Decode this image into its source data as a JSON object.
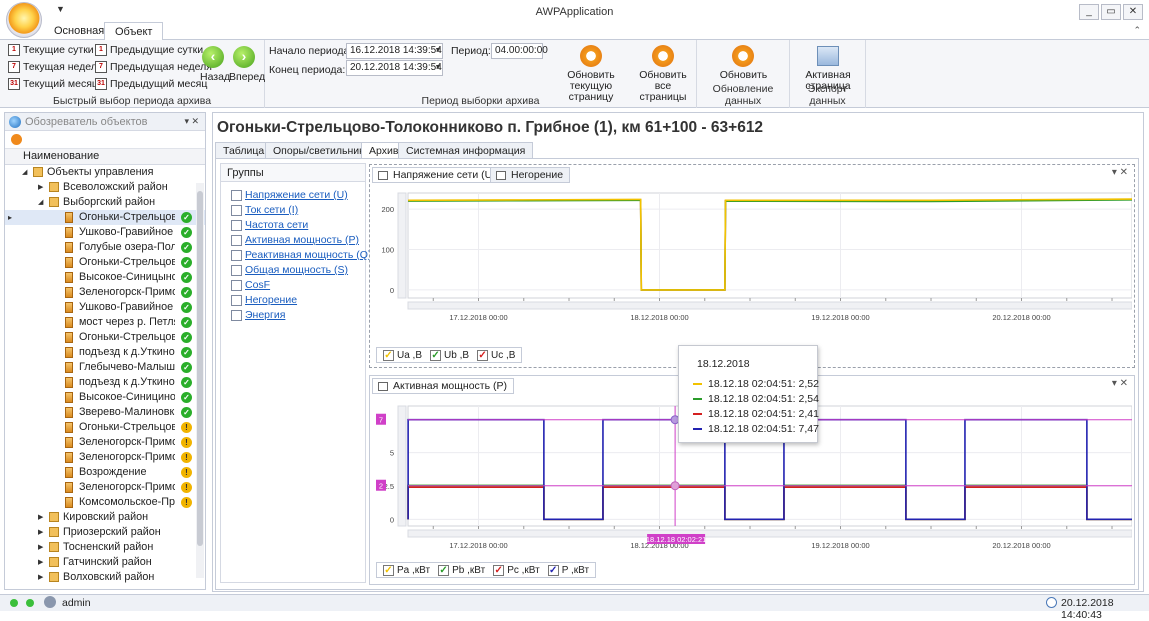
{
  "app": {
    "title": "AWPApplication",
    "ribbon_tabs": [
      "Основная",
      "Объект"
    ],
    "window_buttons": [
      "_",
      "▭",
      "✕"
    ]
  },
  "ribbon": {
    "quick_period": {
      "items": [
        {
          "label": "Текущие сутки",
          "icon": "calendar-day-icon",
          "icon_text": "1"
        },
        {
          "label": "Текущая неделя",
          "icon": "calendar-week-icon",
          "icon_text": "7"
        },
        {
          "label": "Текущий месяц",
          "icon": "calendar-month-icon",
          "icon_text": "31"
        },
        {
          "label": "Предыдущие сутки",
          "icon": "calendar-day-icon",
          "icon_text": "1"
        },
        {
          "label": "Предыдущая неделя",
          "icon": "calendar-week-icon",
          "icon_text": "7"
        },
        {
          "label": "Предыдущий месяц",
          "icon": "calendar-month-icon",
          "icon_text": "31"
        }
      ],
      "back": "Назад",
      "forward": "Вперед",
      "caption": "Быстрый выбор периода архива"
    },
    "period": {
      "start_label": "Начало периода:",
      "start_value": "16.12.2018 14:39:54",
      "end_label": "Конец периода:",
      "end_value": "20.12.2018 14:39:54",
      "period_label": "Период:",
      "period_value": "04.00:00:00",
      "refresh_current": "Обновить текущую страницу",
      "refresh_all": "Обновить все страницы",
      "caption": "Период выборки архива"
    },
    "update": {
      "refresh": "Обновить",
      "caption": "Обновление данных"
    },
    "export": {
      "active_page": "Активная страница",
      "caption": "Экспорт данных"
    }
  },
  "explorer": {
    "title": "Обозреватель объектов",
    "pin": "▾ ✕",
    "column": "Наименование",
    "rows": [
      {
        "level": 0,
        "label": "Объекты управления",
        "icon": "folder",
        "expanded": true
      },
      {
        "level": 1,
        "label": "Всеволожский район",
        "icon": "folder",
        "expanded": false
      },
      {
        "level": 1,
        "label": "Выборгский район",
        "icon": "folder",
        "expanded": true
      },
      {
        "level": 2,
        "label": "Огоньки-Стрельцово",
        "icon": "lamp",
        "status": "ok",
        "selected": true
      },
      {
        "level": 2,
        "label": "Ушково-Гравийное",
        "icon": "lamp",
        "status": "ok"
      },
      {
        "level": 2,
        "label": "Голубые озера-Поля",
        "icon": "lamp",
        "status": "ok"
      },
      {
        "level": 2,
        "label": "Огоньки-Стрельцово",
        "icon": "lamp",
        "status": "ok"
      },
      {
        "level": 2,
        "label": "Высокое-Синицыно",
        "icon": "lamp",
        "status": "ok"
      },
      {
        "level": 2,
        "label": "Зеленогорск-Примо",
        "icon": "lamp",
        "status": "ok"
      },
      {
        "level": 2,
        "label": "Ушково-Гравийное",
        "icon": "lamp",
        "status": "ok"
      },
      {
        "level": 2,
        "label": "мост через р. Петляв",
        "icon": "lamp",
        "status": "ok"
      },
      {
        "level": 2,
        "label": "Огоньки-Стрельцово",
        "icon": "lamp",
        "status": "ok"
      },
      {
        "level": 2,
        "label": "подъезд к д.Уткино д",
        "icon": "lamp",
        "status": "ok"
      },
      {
        "level": 2,
        "label": "Глебычево-Малыше",
        "icon": "lamp",
        "status": "ok"
      },
      {
        "level": 2,
        "label": "подъезд к д.Уткино д",
        "icon": "lamp",
        "status": "ok"
      },
      {
        "level": 2,
        "label": "Высокое-Синицино",
        "icon": "lamp",
        "status": "ok"
      },
      {
        "level": 2,
        "label": "Зверево-Малиновка",
        "icon": "lamp",
        "status": "ok"
      },
      {
        "level": 2,
        "label": "Огоньки-Стрельцово",
        "icon": "lamp",
        "status": "warn"
      },
      {
        "level": 2,
        "label": "Зеленогорск-Примо",
        "icon": "lamp",
        "status": "warn"
      },
      {
        "level": 2,
        "label": "Зеленогорск-Примо",
        "icon": "lamp",
        "status": "warn"
      },
      {
        "level": 2,
        "label": "Возрождение",
        "icon": "lamp",
        "status": "warn"
      },
      {
        "level": 2,
        "label": "Зеленогорск-Примо",
        "icon": "lamp",
        "status": "warn"
      },
      {
        "level": 2,
        "label": "Комсомольское-При",
        "icon": "lamp",
        "status": "warn"
      },
      {
        "level": 1,
        "label": "Кировский район",
        "icon": "folder",
        "expanded": false
      },
      {
        "level": 1,
        "label": "Приозерский район",
        "icon": "folder",
        "expanded": false
      },
      {
        "level": 1,
        "label": "Тосненский район",
        "icon": "folder",
        "expanded": false
      },
      {
        "level": 1,
        "label": "Гатчинский район",
        "icon": "folder",
        "expanded": false
      },
      {
        "level": 1,
        "label": "Волховский район",
        "icon": "folder",
        "expanded": false
      }
    ]
  },
  "content": {
    "title": "Огоньки-Стрельцово-Толоконниково п. Грибное (1), км 61+100 - 63+612",
    "tabs": [
      "Таблица",
      "Опоры/светильники",
      "Архив",
      "Системная информация"
    ],
    "active_tab": "Архив",
    "groups_title": "Группы",
    "groups": [
      "Напряжение сети (U)",
      "Ток сети (I)",
      "Частота сети",
      "Активная мощность (P)",
      "Реактивная мощность (Q)",
      "Общая мощность (S)",
      "CosF",
      "Негорение",
      "Энергия"
    ]
  },
  "chart_top": {
    "tabs": [
      "Напряжение сети (U)",
      "Негорение"
    ],
    "legend": [
      "Ua ,В",
      "Ub ,В",
      "Uc ,В"
    ]
  },
  "chart_bottom": {
    "tabs": [
      "Активная мощность (P)"
    ],
    "legend": [
      "Pa ,кВт",
      "Pb ,кВт",
      "Pc ,кВт",
      "P ,кВт"
    ],
    "crosshair_label": "18.12.18 02:02:21",
    "y_marker_top": "7",
    "y_marker_mid": "2"
  },
  "tooltip": {
    "header": "18.12.2018",
    "rows": [
      {
        "text": "18.12.18 02:04:51: 2,52",
        "color": "#f2c200"
      },
      {
        "text": "18.12.18 02:04:51: 2,54",
        "color": "#2a9b2a"
      },
      {
        "text": "18.12.18 02:04:51: 2,41",
        "color": "#d42020"
      },
      {
        "text": "18.12.18 02:04:51: 7,47",
        "color": "#2222b0"
      }
    ]
  },
  "status": {
    "user": "admin",
    "datetime": "20.12.2018 14:40:43"
  },
  "chart_data": [
    {
      "type": "line",
      "x": [
        "17.12.2018 00:00",
        "18.12.2018 00:00",
        "19.12.2018 00:00",
        "20.12.2018 00:00"
      ],
      "xlabel": "",
      "ylabel": "",
      "ylim": [
        -20,
        240
      ],
      "yticks": [
        0,
        100,
        200
      ],
      "series": [
        {
          "name": "Ua ,В",
          "color": "#f2c200",
          "points": [
            [
              "16.12.2018 14:40",
              222
            ],
            [
              "17.12.2018 06:00",
              223
            ],
            [
              "17.12.2018 21:30",
              224
            ],
            [
              "17.12.2018 21:35",
              0
            ],
            [
              "18.12.2018 08:40",
              0
            ],
            [
              "18.12.2018 08:45",
              222
            ],
            [
              "19.12.2018 12:00",
              222
            ],
            [
              "20.12.2018 14:39",
              225
            ]
          ]
        },
        {
          "name": "Ub ,В",
          "color": "#2a9b2a",
          "points": [
            [
              "16.12.2018 14:40",
              220
            ],
            [
              "17.12.2018 06:00",
              221
            ],
            [
              "17.12.2018 21:30",
              222
            ],
            [
              "17.12.2018 21:35",
              0
            ],
            [
              "18.12.2018 08:40",
              0
            ],
            [
              "18.12.2018 08:45",
              220
            ],
            [
              "19.12.2018 12:00",
              219
            ],
            [
              "20.12.2018 14:39",
              223
            ]
          ]
        },
        {
          "name": "Uc ,В",
          "color": "#d42020",
          "points": [
            [
              "16.12.2018 14:40",
              221
            ],
            [
              "17.12.2018 06:00",
              222
            ],
            [
              "17.12.2018 21:30",
              223
            ],
            [
              "17.12.2018 21:35",
              0
            ],
            [
              "18.12.2018 08:40",
              0
            ],
            [
              "18.12.2018 08:45",
              221
            ],
            [
              "19.12.2018 12:00",
              220
            ],
            [
              "20.12.2018 14:39",
              224
            ]
          ]
        }
      ]
    },
    {
      "type": "line",
      "x": [
        "17.12.2018 00:00",
        "18.12.2018 00:00",
        "19.12.2018 00:00",
        "20.12.2018 00:00"
      ],
      "xlabel": "",
      "ylabel": "",
      "ylim": [
        -0.5,
        8.5
      ],
      "yticks": [
        0,
        2.5,
        5
      ],
      "on_periods": [
        [
          "16.12.2018 14:40",
          "17.12.2018 08:40"
        ],
        [
          "17.12.2018 16:30",
          "18.12.2018 08:40"
        ],
        [
          "18.12.2018 16:30",
          "19.12.2018 08:40"
        ],
        [
          "19.12.2018 16:30",
          "20.12.2018 08:40"
        ]
      ],
      "series": [
        {
          "name": "Pa ,кВт",
          "color": "#f2c200",
          "on_value": 2.52,
          "off_value": 0
        },
        {
          "name": "Pb ,кВт",
          "color": "#2a9b2a",
          "on_value": 2.54,
          "off_value": 0
        },
        {
          "name": "Pc ,кВт",
          "color": "#d42020",
          "on_value": 2.41,
          "off_value": 0
        },
        {
          "name": "P ,кВт",
          "color": "#2222b0",
          "on_value": 7.47,
          "off_value": 0
        }
      ]
    }
  ]
}
